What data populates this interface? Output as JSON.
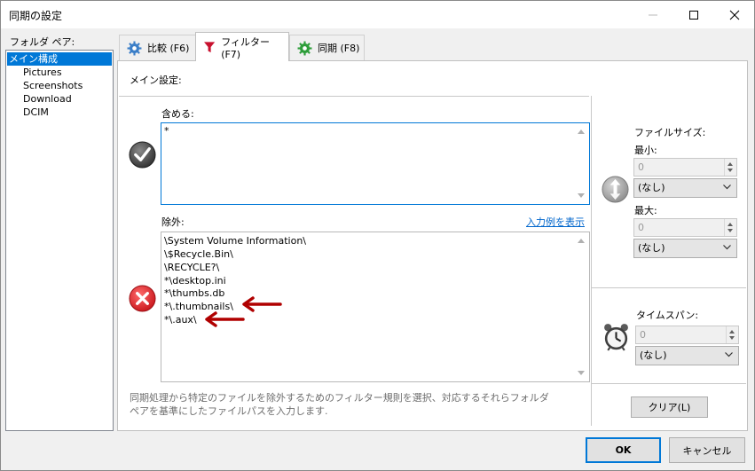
{
  "window": {
    "title": "同期の設定"
  },
  "sidebar": {
    "label": "フォルダ ペア:",
    "items": [
      {
        "label": "メイン構成",
        "selected": true
      },
      {
        "label": "Pictures"
      },
      {
        "label": "Screenshots"
      },
      {
        "label": "Download"
      },
      {
        "label": "DCIM"
      }
    ]
  },
  "tabs": [
    {
      "label": "比較 (F6)",
      "icon": "gear-icon-blue"
    },
    {
      "label": "フィルター (F7)",
      "icon": "funnel-icon-red",
      "active": true
    },
    {
      "label": "同期 (F8)",
      "icon": "gear-icon-green"
    }
  ],
  "panel": {
    "heading": "メイン設定:",
    "include": {
      "label": "含める:",
      "lines": [
        "*"
      ]
    },
    "exclude": {
      "label": "除外:",
      "examples_link": "入力例を表示",
      "lines": [
        "\\System Volume Information\\",
        "\\$Recycle.Bin\\",
        "\\RECYCLE?\\",
        "*\\desktop.ini",
        "*\\thumbs.db",
        "*\\.thumbnails\\",
        "*\\.aux\\"
      ]
    },
    "help": "同期処理から特定のファイルを除外するためのフィルター規則を選択、対応するそれらフォルダ\nペアを基準にしたファイルパスを入力します."
  },
  "filesize": {
    "label": "ファイルサイズ:",
    "min_label": "最小:",
    "min_value": "0",
    "min_unit": "(なし)",
    "max_label": "最大:",
    "max_value": "0",
    "max_unit": "(なし)"
  },
  "timespan": {
    "label": "タイムスパン:",
    "value": "0",
    "unit": "(なし)"
  },
  "buttons": {
    "clear": "クリア(L)",
    "ok": "OK",
    "cancel": "キャンセル"
  },
  "colors": {
    "accent": "#0078d7",
    "arrow": "#b00000",
    "exclude_icon": "#e0282c"
  }
}
